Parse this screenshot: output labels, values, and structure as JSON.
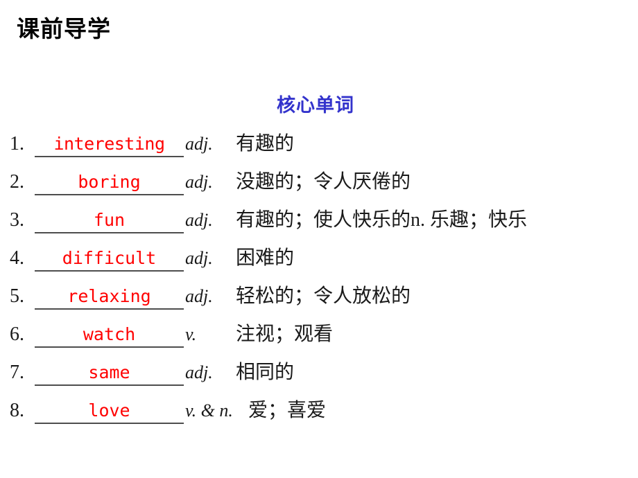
{
  "slide": {
    "title": "课前导学",
    "section_heading": "核心单词",
    "colors": {
      "heading_blue": "#3333cc",
      "answer_red": "#ff0000",
      "text_black": "#1a1a1a",
      "blank_line": "#4d4d4d",
      "background": "#ffffff"
    }
  },
  "vocabulary": [
    {
      "number": "1.",
      "answer": "interesting",
      "part_of_speech": "adj.",
      "meaning": "有趣的"
    },
    {
      "number": "2.",
      "answer": "boring",
      "part_of_speech": "adj.",
      "meaning": "没趣的；令人厌倦的"
    },
    {
      "number": "3.",
      "answer": "fun",
      "part_of_speech": "adj.",
      "meaning": "有趣的；使人快乐的n. 乐趣；快乐"
    },
    {
      "number": "4.",
      "answer": "difficult",
      "part_of_speech": "adj.",
      "meaning": "困难的"
    },
    {
      "number": "5.",
      "answer": "relaxing",
      "part_of_speech": "adj.",
      "meaning": "轻松的；令人放松的"
    },
    {
      "number": "6.",
      "answer": "watch",
      "part_of_speech": "v.",
      "meaning": "注视；观看"
    },
    {
      "number": "7.",
      "answer": "same",
      "part_of_speech": "adj.",
      "meaning": "相同的"
    },
    {
      "number": "8.",
      "answer": "love",
      "part_of_speech": "v. & n.",
      "meaning": "爱；喜爱"
    }
  ]
}
